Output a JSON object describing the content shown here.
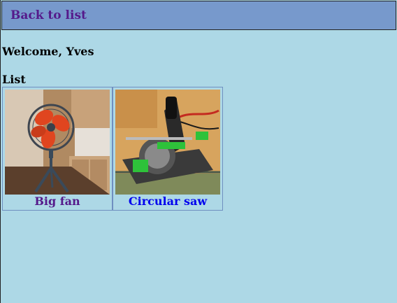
{
  "header": {
    "back_link": "Back to list"
  },
  "main": {
    "welcome": "Welcome, Yves",
    "list_title": "List",
    "items": [
      {
        "name": "Big fan",
        "image_icon": "fan-photo"
      },
      {
        "name": "Circular saw",
        "image_icon": "circular-saw-photo"
      }
    ]
  },
  "colors": {
    "background": "#add8e6",
    "header_bg": "#7799cc",
    "visited_link": "#551a8b",
    "link": "#0000ee"
  }
}
